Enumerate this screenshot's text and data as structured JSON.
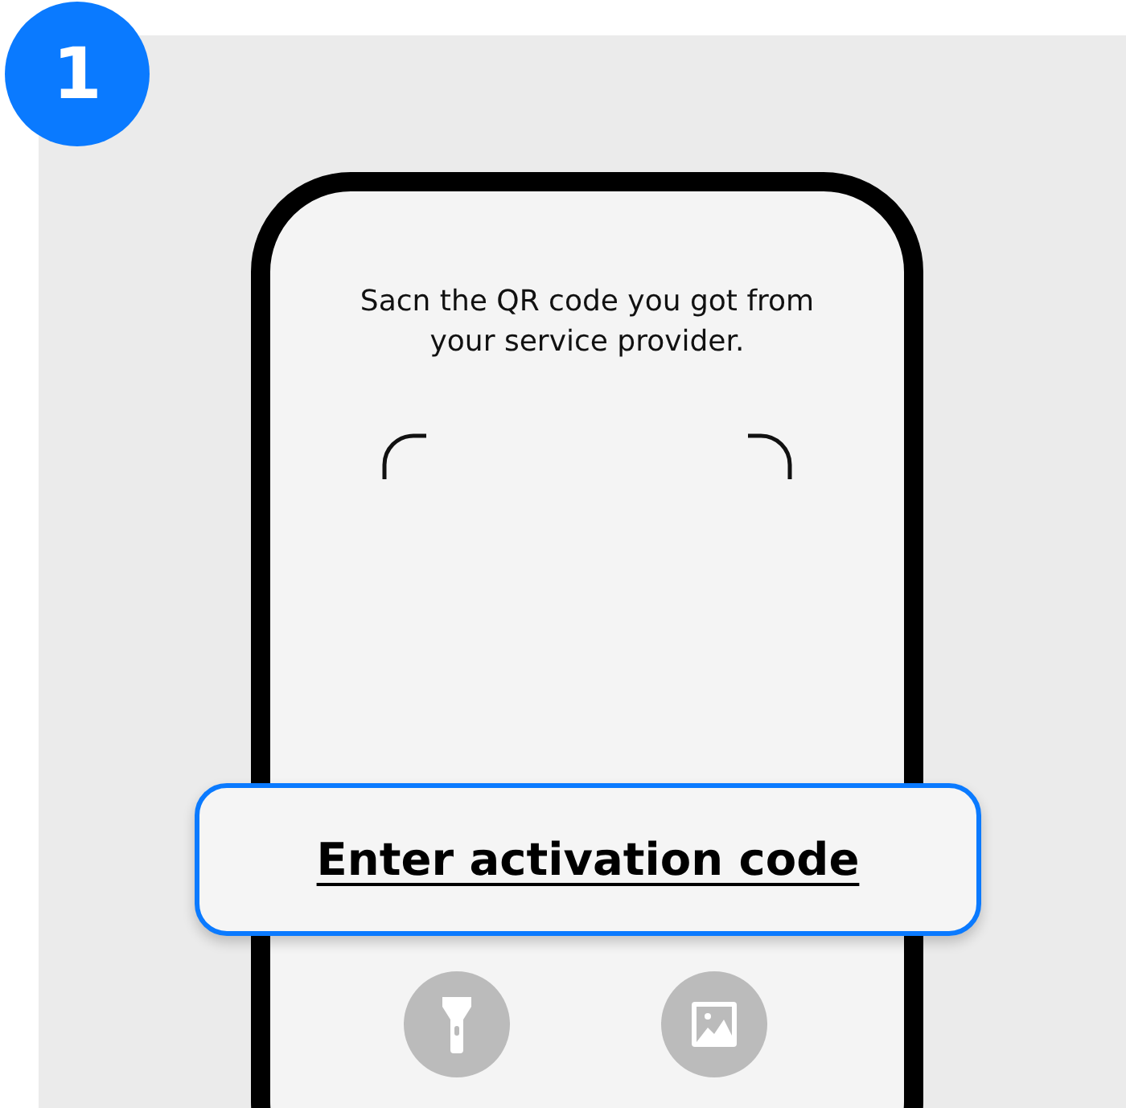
{
  "step_badge": "1",
  "scanner": {
    "instruction": "Sacn the QR code you got from your service provider.",
    "enter_code_link": "Enter activation code"
  }
}
